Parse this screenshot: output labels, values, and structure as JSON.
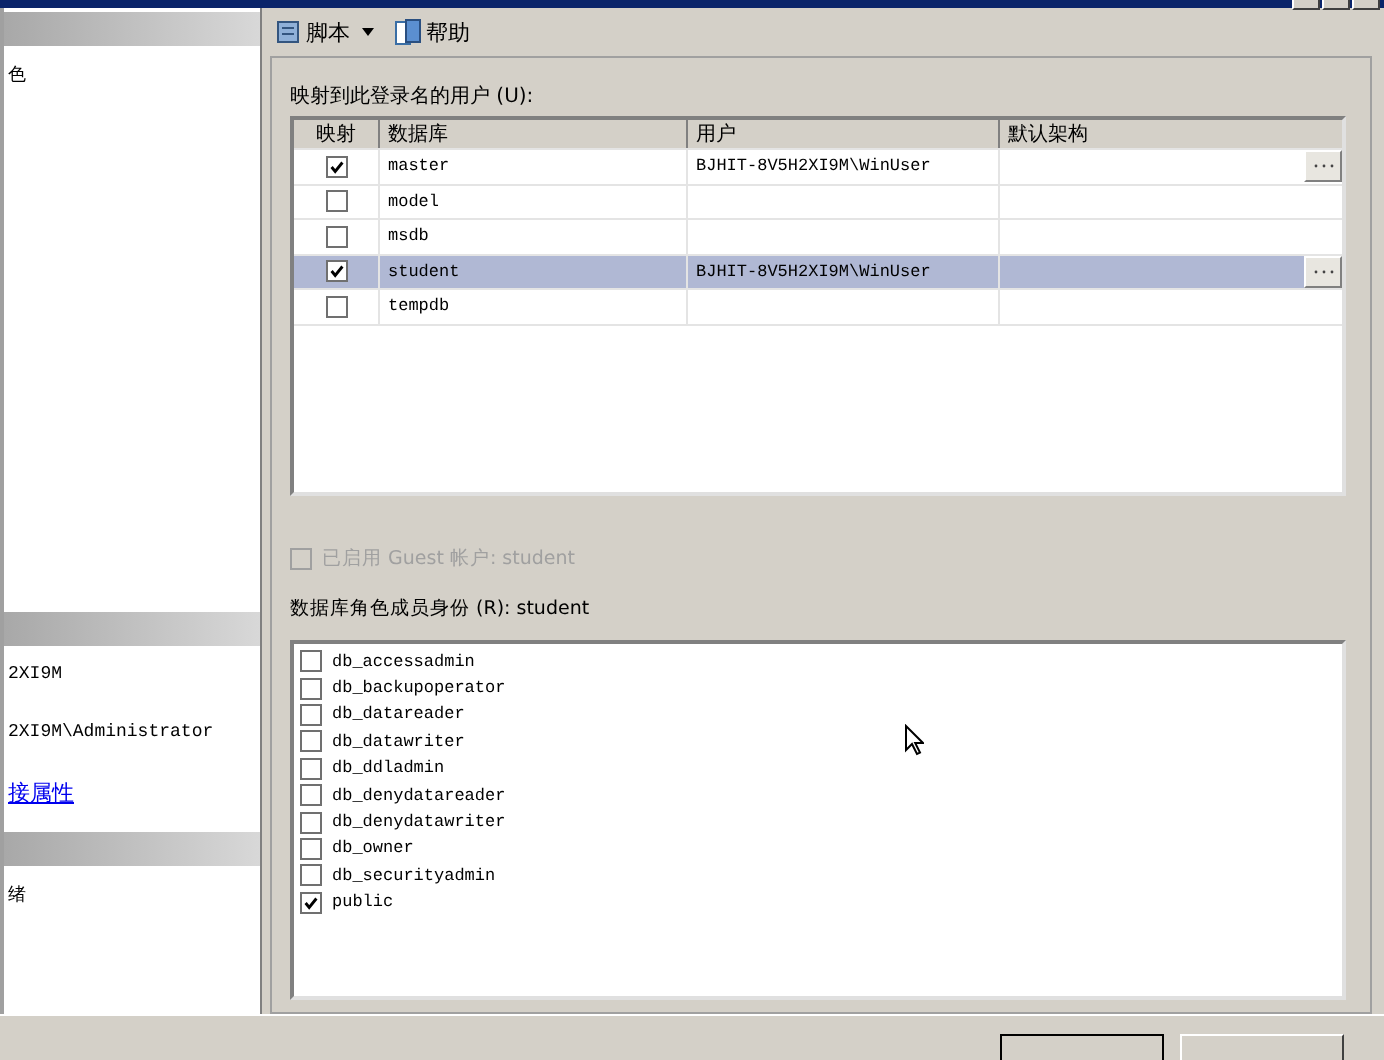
{
  "toolbar": [
    {
      "kind": "dropdown",
      "label": "脚本"
    },
    {
      "kind": "button",
      "label": "帮助"
    }
  ],
  "sidebar": [
    {
      "kind": "header"
    },
    {
      "kind": "text",
      "text": "色"
    },
    {
      "kind": "spacer"
    },
    {
      "kind": "header"
    },
    {
      "kind": "text",
      "text": "2XI9M"
    },
    {
      "kind": "text",
      "text": "2XI9M\\Administrator"
    },
    {
      "kind": "link",
      "text": "接属性"
    },
    {
      "kind": "header"
    },
    {
      "kind": "text",
      "text": "绪"
    }
  ],
  "mapping": {
    "label": "映射到此登录名的用户 (U):",
    "columns": [
      "映射",
      "数据库",
      "用户",
      "默认架构"
    ],
    "rows": [
      {
        "checked": true,
        "database": "master",
        "user": "BJHIT-8V5H2XI9M\\WinUser",
        "browse": true,
        "selected": false
      },
      {
        "checked": false,
        "database": "model",
        "browse": false,
        "selected": false
      },
      {
        "checked": false,
        "database": "msdb",
        "browse": false,
        "selected": false
      },
      {
        "checked": true,
        "database": "student",
        "user": "BJHIT-8V5H2XI9M\\WinUser",
        "browse": true,
        "selected": true
      },
      {
        "checked": false,
        "database": "tempdb",
        "browse": false,
        "selected": false
      }
    ]
  },
  "guest": {
    "label": "已启用 Guest 帐户: student",
    "checked": false,
    "disabled": true
  },
  "roles": {
    "label": "数据库角色成员身份 (R): student",
    "items": [
      {
        "name": "db_accessadmin",
        "checked": false
      },
      {
        "name": "db_backupoperator",
        "checked": false
      },
      {
        "name": "db_datareader",
        "checked": false
      },
      {
        "name": "db_datawriter",
        "checked": false
      },
      {
        "name": "db_ddladmin",
        "checked": false
      },
      {
        "name": "db_denydatareader",
        "checked": false
      },
      {
        "name": "db_denydatawriter",
        "checked": false
      },
      {
        "name": "db_owner",
        "checked": false
      },
      {
        "name": "db_securityadmin",
        "checked": false
      },
      {
        "name": "public",
        "checked": true
      }
    ]
  },
  "dialog_buttons": [
    {
      "default": true
    },
    {
      "default": false
    }
  ]
}
